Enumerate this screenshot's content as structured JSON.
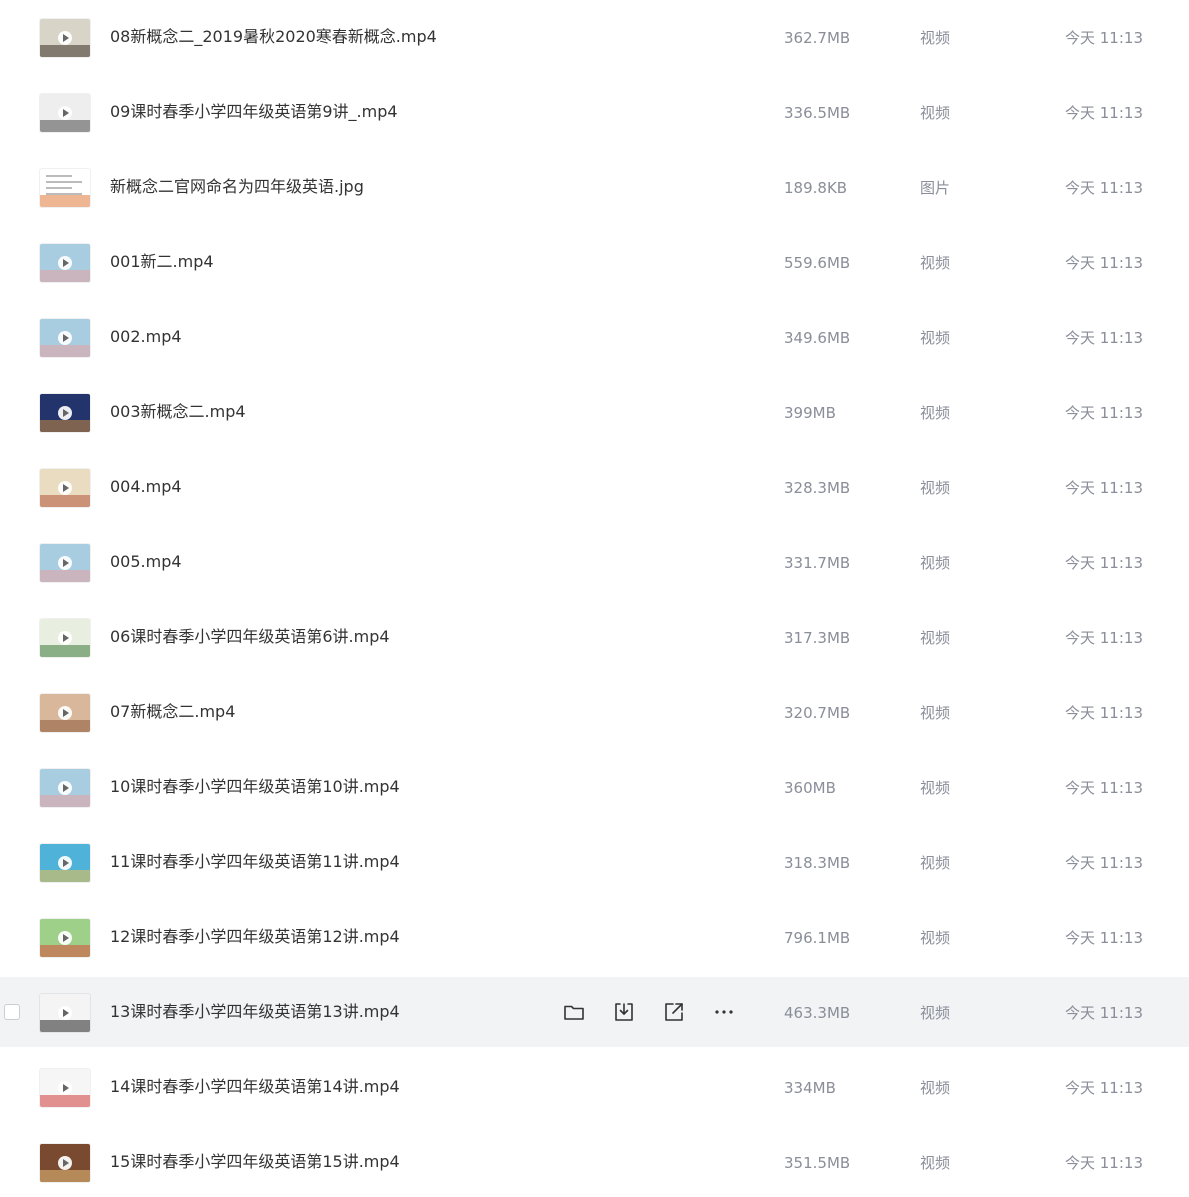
{
  "hover_row_index": 13,
  "row_actions": [
    {
      "name": "move-to-folder",
      "icon": "folder-icon"
    },
    {
      "name": "download",
      "icon": "download-icon"
    },
    {
      "name": "share",
      "icon": "share-external-icon"
    },
    {
      "name": "more",
      "icon": "more-horizontal-icon"
    }
  ],
  "files": [
    {
      "name": "08新概念二_2019暑秋2020寒春新概念.mp4",
      "size": "362.7MB",
      "type": "视频",
      "date": "今天 11:13",
      "thumb": {
        "kind": "video",
        "bg": "#d9d4c8",
        "accent": "#3b2f25"
      }
    },
    {
      "name": "09课时春季小学四年级英语第9讲_.mp4",
      "size": "336.5MB",
      "type": "视频",
      "date": "今天 11:13",
      "thumb": {
        "kind": "video",
        "bg": "#eeeeee",
        "accent": "#4a4a4a"
      }
    },
    {
      "name": "新概念二官网命名为四年级英语.jpg",
      "size": "189.8KB",
      "type": "图片",
      "date": "今天 11:13",
      "thumb": {
        "kind": "image",
        "bg": "#ffffff",
        "accent": "#e07a3a"
      }
    },
    {
      "name": "001新二.mp4",
      "size": "559.6MB",
      "type": "视频",
      "date": "今天 11:13",
      "thumb": {
        "kind": "video",
        "bg": "#a9cde0",
        "accent": "#e6a0a0"
      }
    },
    {
      "name": "002.mp4",
      "size": "349.6MB",
      "type": "视频",
      "date": "今天 11:13",
      "thumb": {
        "kind": "video",
        "bg": "#a9cde0",
        "accent": "#e6a0a0"
      }
    },
    {
      "name": "003新概念二.mp4",
      "size": "399MB",
      "type": "视频",
      "date": "今天 11:13",
      "thumb": {
        "kind": "video",
        "bg": "#23336b",
        "accent": "#c98a3a"
      }
    },
    {
      "name": "004.mp4",
      "size": "328.3MB",
      "type": "视频",
      "date": "今天 11:13",
      "thumb": {
        "kind": "video",
        "bg": "#e9dcc0",
        "accent": "#b5553a"
      }
    },
    {
      "name": "005.mp4",
      "size": "331.7MB",
      "type": "视频",
      "date": "今天 11:13",
      "thumb": {
        "kind": "video",
        "bg": "#a9cde0",
        "accent": "#e6a0a0"
      }
    },
    {
      "name": "06课时春季小学四年级英语第6讲.mp4",
      "size": "317.3MB",
      "type": "视频",
      "date": "今天 11:13",
      "thumb": {
        "kind": "video",
        "bg": "#e8efe0",
        "accent": "#3c7a3c"
      }
    },
    {
      "name": "07新概念二.mp4",
      "size": "320.7MB",
      "type": "视频",
      "date": "今天 11:13",
      "thumb": {
        "kind": "video",
        "bg": "#d9b79a",
        "accent": "#8c5a3a"
      }
    },
    {
      "name": "10课时春季小学四年级英语第10讲.mp4",
      "size": "360MB",
      "type": "视频",
      "date": "今天 11:13",
      "thumb": {
        "kind": "video",
        "bg": "#a9cde0",
        "accent": "#e6a0a0"
      }
    },
    {
      "name": "11课时春季小学四年级英语第11讲.mp4",
      "size": "318.3MB",
      "type": "视频",
      "date": "今天 11:13",
      "thumb": {
        "kind": "video",
        "bg": "#4fb3d9",
        "accent": "#f4c048"
      }
    },
    {
      "name": "12课时春季小学四年级英语第12讲.mp4",
      "size": "796.1MB",
      "type": "视频",
      "date": "今天 11:13",
      "thumb": {
        "kind": "video",
        "bg": "#9ed08a",
        "accent": "#d94a3a"
      }
    },
    {
      "name": "13课时春季小学四年级英语第13讲.mp4",
      "size": "463.3MB",
      "type": "视频",
      "date": "今天 11:13",
      "thumb": {
        "kind": "video",
        "bg": "#f4f4f4",
        "accent": "#222222"
      }
    },
    {
      "name": "14课时春季小学四年级英语第14讲.mp4",
      "size": "334MB",
      "type": "视频",
      "date": "今天 11:13",
      "thumb": {
        "kind": "video",
        "bg": "#f6f6f6",
        "accent": "#d03a3a"
      }
    },
    {
      "name": "15课时春季小学四年级英语第15讲.mp4",
      "size": "351.5MB",
      "type": "视频",
      "date": "今天 11:13",
      "thumb": {
        "kind": "video",
        "bg": "#7a4a30",
        "accent": "#e8c07a"
      }
    }
  ]
}
